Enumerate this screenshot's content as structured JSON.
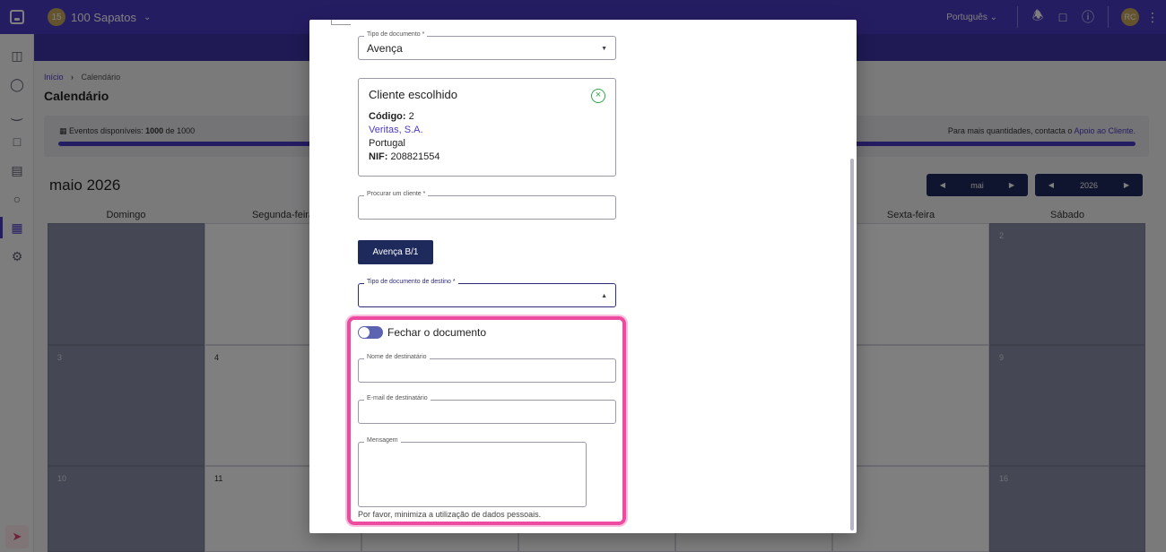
{
  "topbar": {
    "company_initials": "15",
    "company_name": "100 Sapatos",
    "language": "Português",
    "user_initials": "RC"
  },
  "breadcrumb": {
    "home": "Início",
    "current": "Calendário"
  },
  "page_title": "Calendário",
  "events": {
    "label": "Eventos disponíveis:",
    "used": "1000",
    "of_text": "de 1000",
    "more_text": "Para mais quantidades, contacta o",
    "support_link": "Apoio ao Cliente."
  },
  "calendar": {
    "month_title": "maio 2026",
    "month_nav_value": "mai",
    "year_nav_value": "2026",
    "weekdays": [
      "Domingo",
      "Segunda-feira",
      "Sexta-feira",
      "Sábado"
    ],
    "days": [
      "2",
      "3",
      "4",
      "9",
      "10",
      "11",
      "16"
    ]
  },
  "modal": {
    "doc_type": {
      "label": "Tipo de documento *",
      "value": "Avença"
    },
    "client_card": {
      "title": "Cliente escolhido",
      "code_label": "Código:",
      "code_value": "2",
      "name": "Veritas, S.A.",
      "country": "Portugal",
      "nif_label": "NIF:",
      "nif_value": "208821554"
    },
    "search_client": {
      "label": "Procurar um cliente *",
      "value": ""
    },
    "series_button": "Avença B/1",
    "target_doc_type": {
      "label": "Tipo de documento de destino *",
      "value": ""
    },
    "close_document_label": "Fechar o documento",
    "recipient_name": {
      "label": "Nome de destinatário",
      "value": ""
    },
    "recipient_email": {
      "label": "E-mail de destinatário",
      "value": ""
    },
    "message": {
      "label": "Mensagem",
      "value": ""
    },
    "privacy_hint": "Por favor, minimiza a utilização de dados pessoais."
  },
  "colors": {
    "primary": "#4a3bc4",
    "dark_button": "#1f2a5c",
    "highlight": "#ec4ba0",
    "success": "#2ea64a"
  }
}
